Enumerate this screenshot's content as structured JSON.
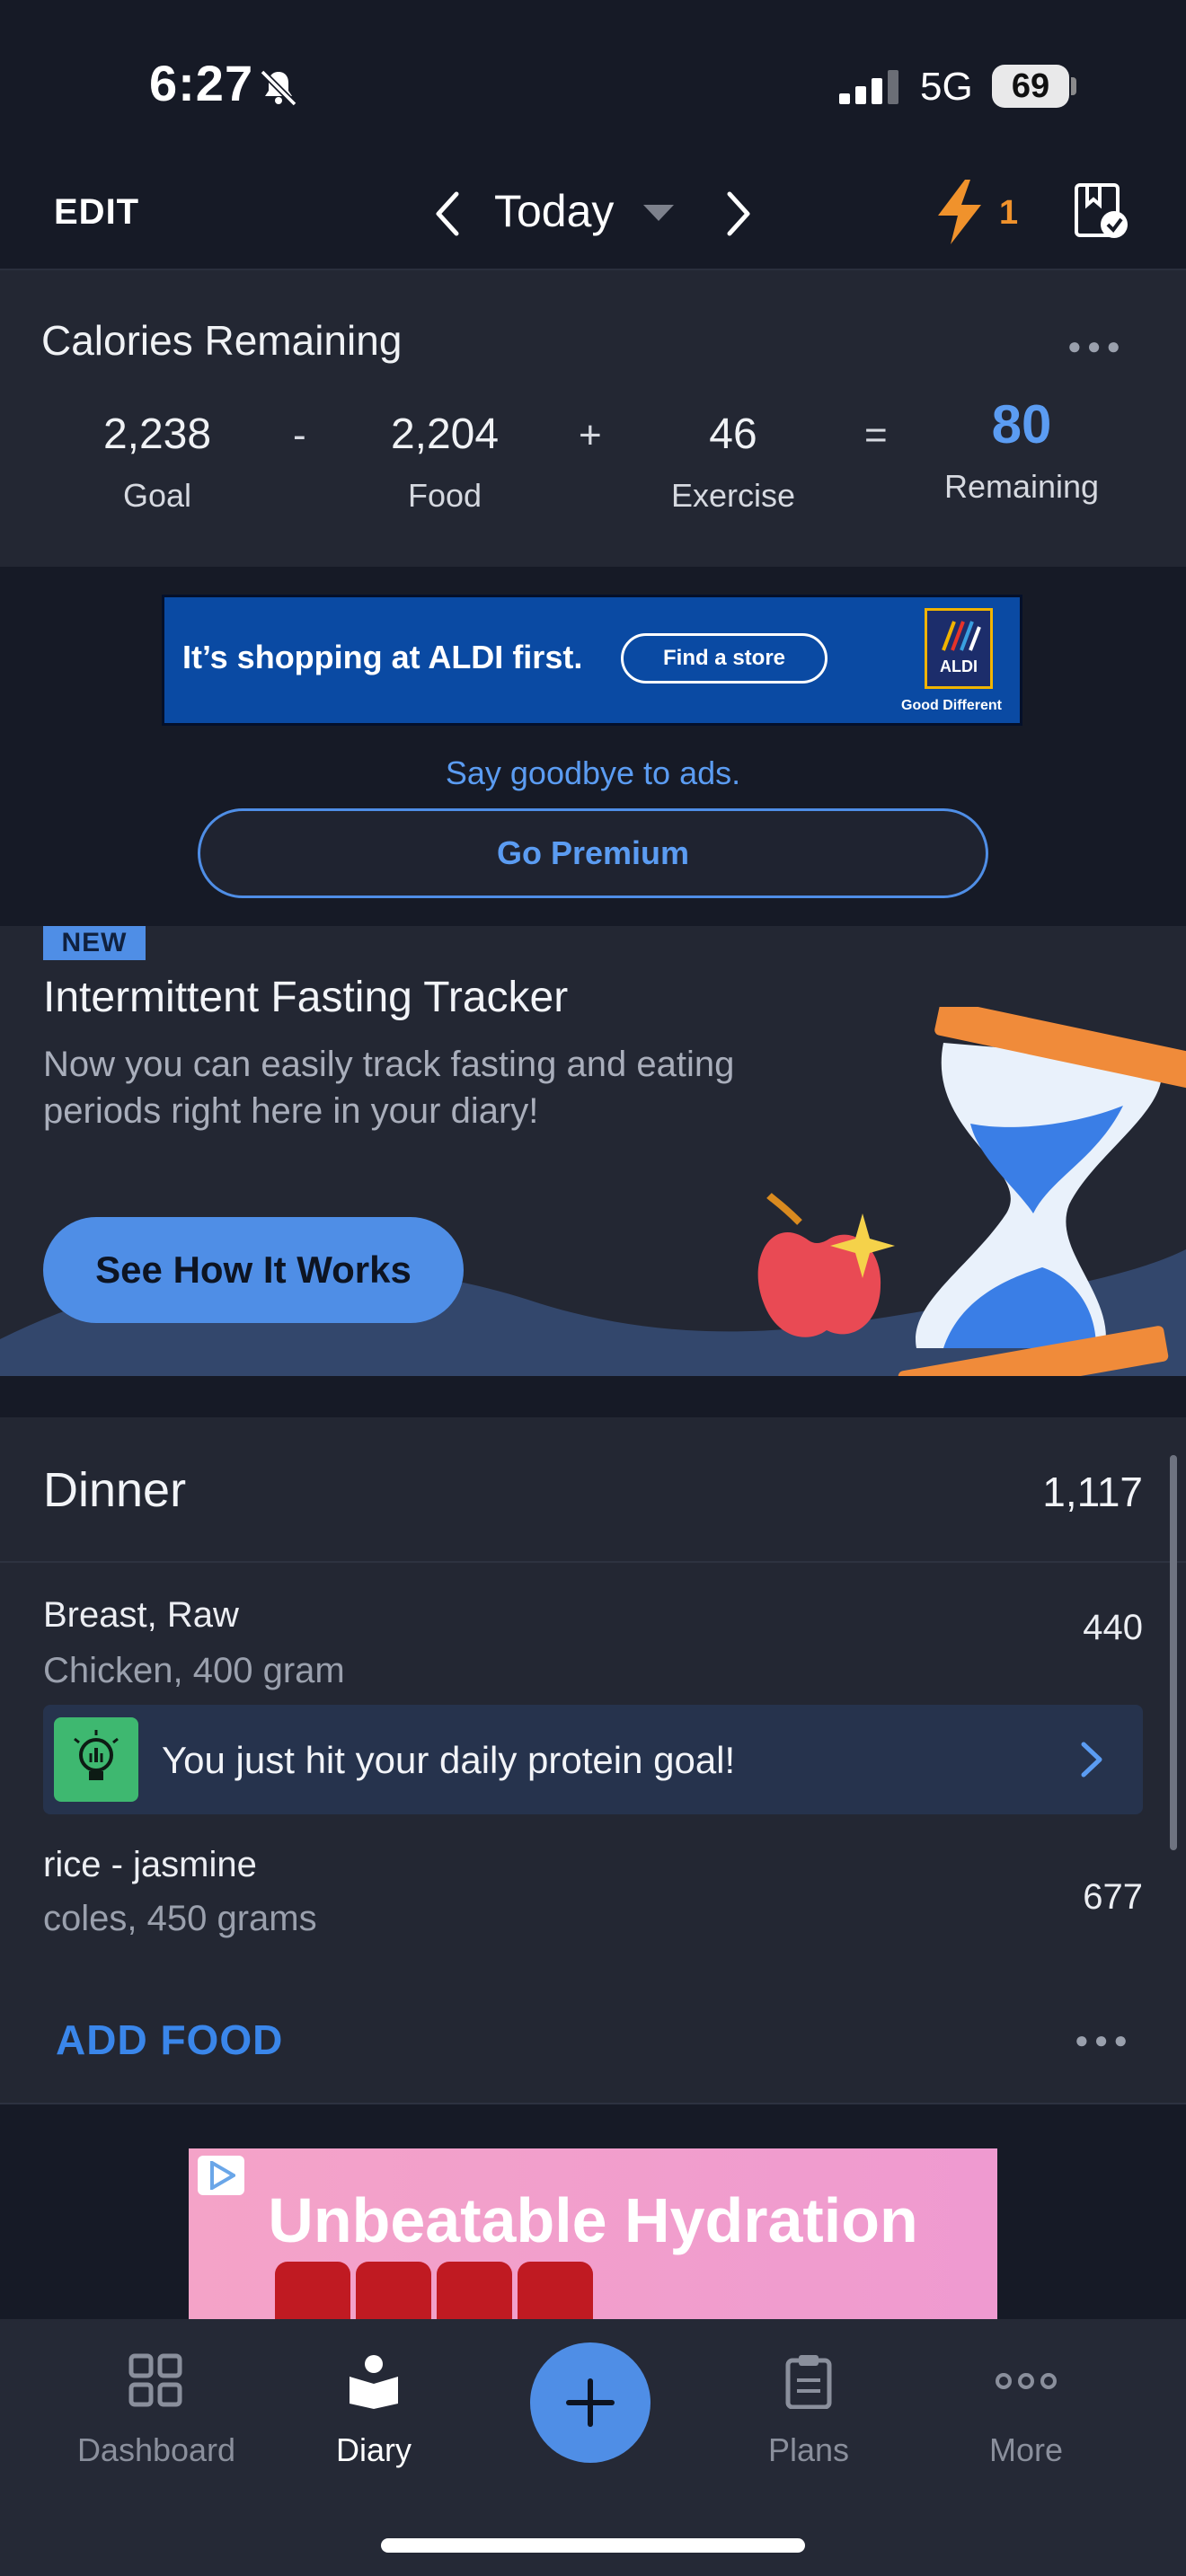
{
  "status_bar": {
    "time": "6:27",
    "network": "5G",
    "battery": "69"
  },
  "top_nav": {
    "edit_label": "EDIT",
    "date_label": "Today",
    "streak_count": "1"
  },
  "calories": {
    "title": "Calories Remaining",
    "goal": {
      "value": "2,238",
      "label": "Goal"
    },
    "food": {
      "value": "2,204",
      "label": "Food"
    },
    "exercise": {
      "value": "46",
      "label": "Exercise"
    },
    "remaining": {
      "value": "80",
      "label": "Remaining"
    },
    "op_minus": "-",
    "op_plus": "+",
    "op_equals": "="
  },
  "aldi_ad": {
    "headline": "It’s shopping at ALDI first.",
    "button": "Find a store",
    "logo": "ALDI",
    "tagline": "Good Different"
  },
  "premium": {
    "goodbye_text": "Say goodbye to ads.",
    "button_label": "Go Premium"
  },
  "promo": {
    "badge": "NEW",
    "title": "Intermittent Fasting Tracker",
    "description": "Now you can easily track fasting and eating periods right here in your diary!",
    "button_label": "See How It Works"
  },
  "dinner": {
    "title": "Dinner",
    "total": "1,117",
    "items": [
      {
        "name": "Breast, Raw",
        "detail": "Chicken, 400 gram",
        "calories": "440"
      },
      {
        "name": "rice - jasmine",
        "detail": "coles, 450 grams",
        "calories": "677"
      }
    ],
    "tip": "You just hit your daily protein goal!",
    "add_food_label": "ADD FOOD"
  },
  "hydration_ad": {
    "headline": "Unbeatable Hydration"
  },
  "tabbar": {
    "tabs": [
      {
        "label": "Dashboard",
        "icon": "dashboard-grid-icon"
      },
      {
        "label": "Diary",
        "icon": "diary-book-icon",
        "active": true
      },
      {
        "label": "Plans",
        "icon": "clipboard-icon"
      },
      {
        "label": "More",
        "icon": "more-dots-icon"
      }
    ]
  },
  "colors": {
    "accent": "#4f8ee6",
    "background": "#161a26",
    "card": "#232733",
    "streak": "#f0922c",
    "tip_green": "#3eb870"
  }
}
